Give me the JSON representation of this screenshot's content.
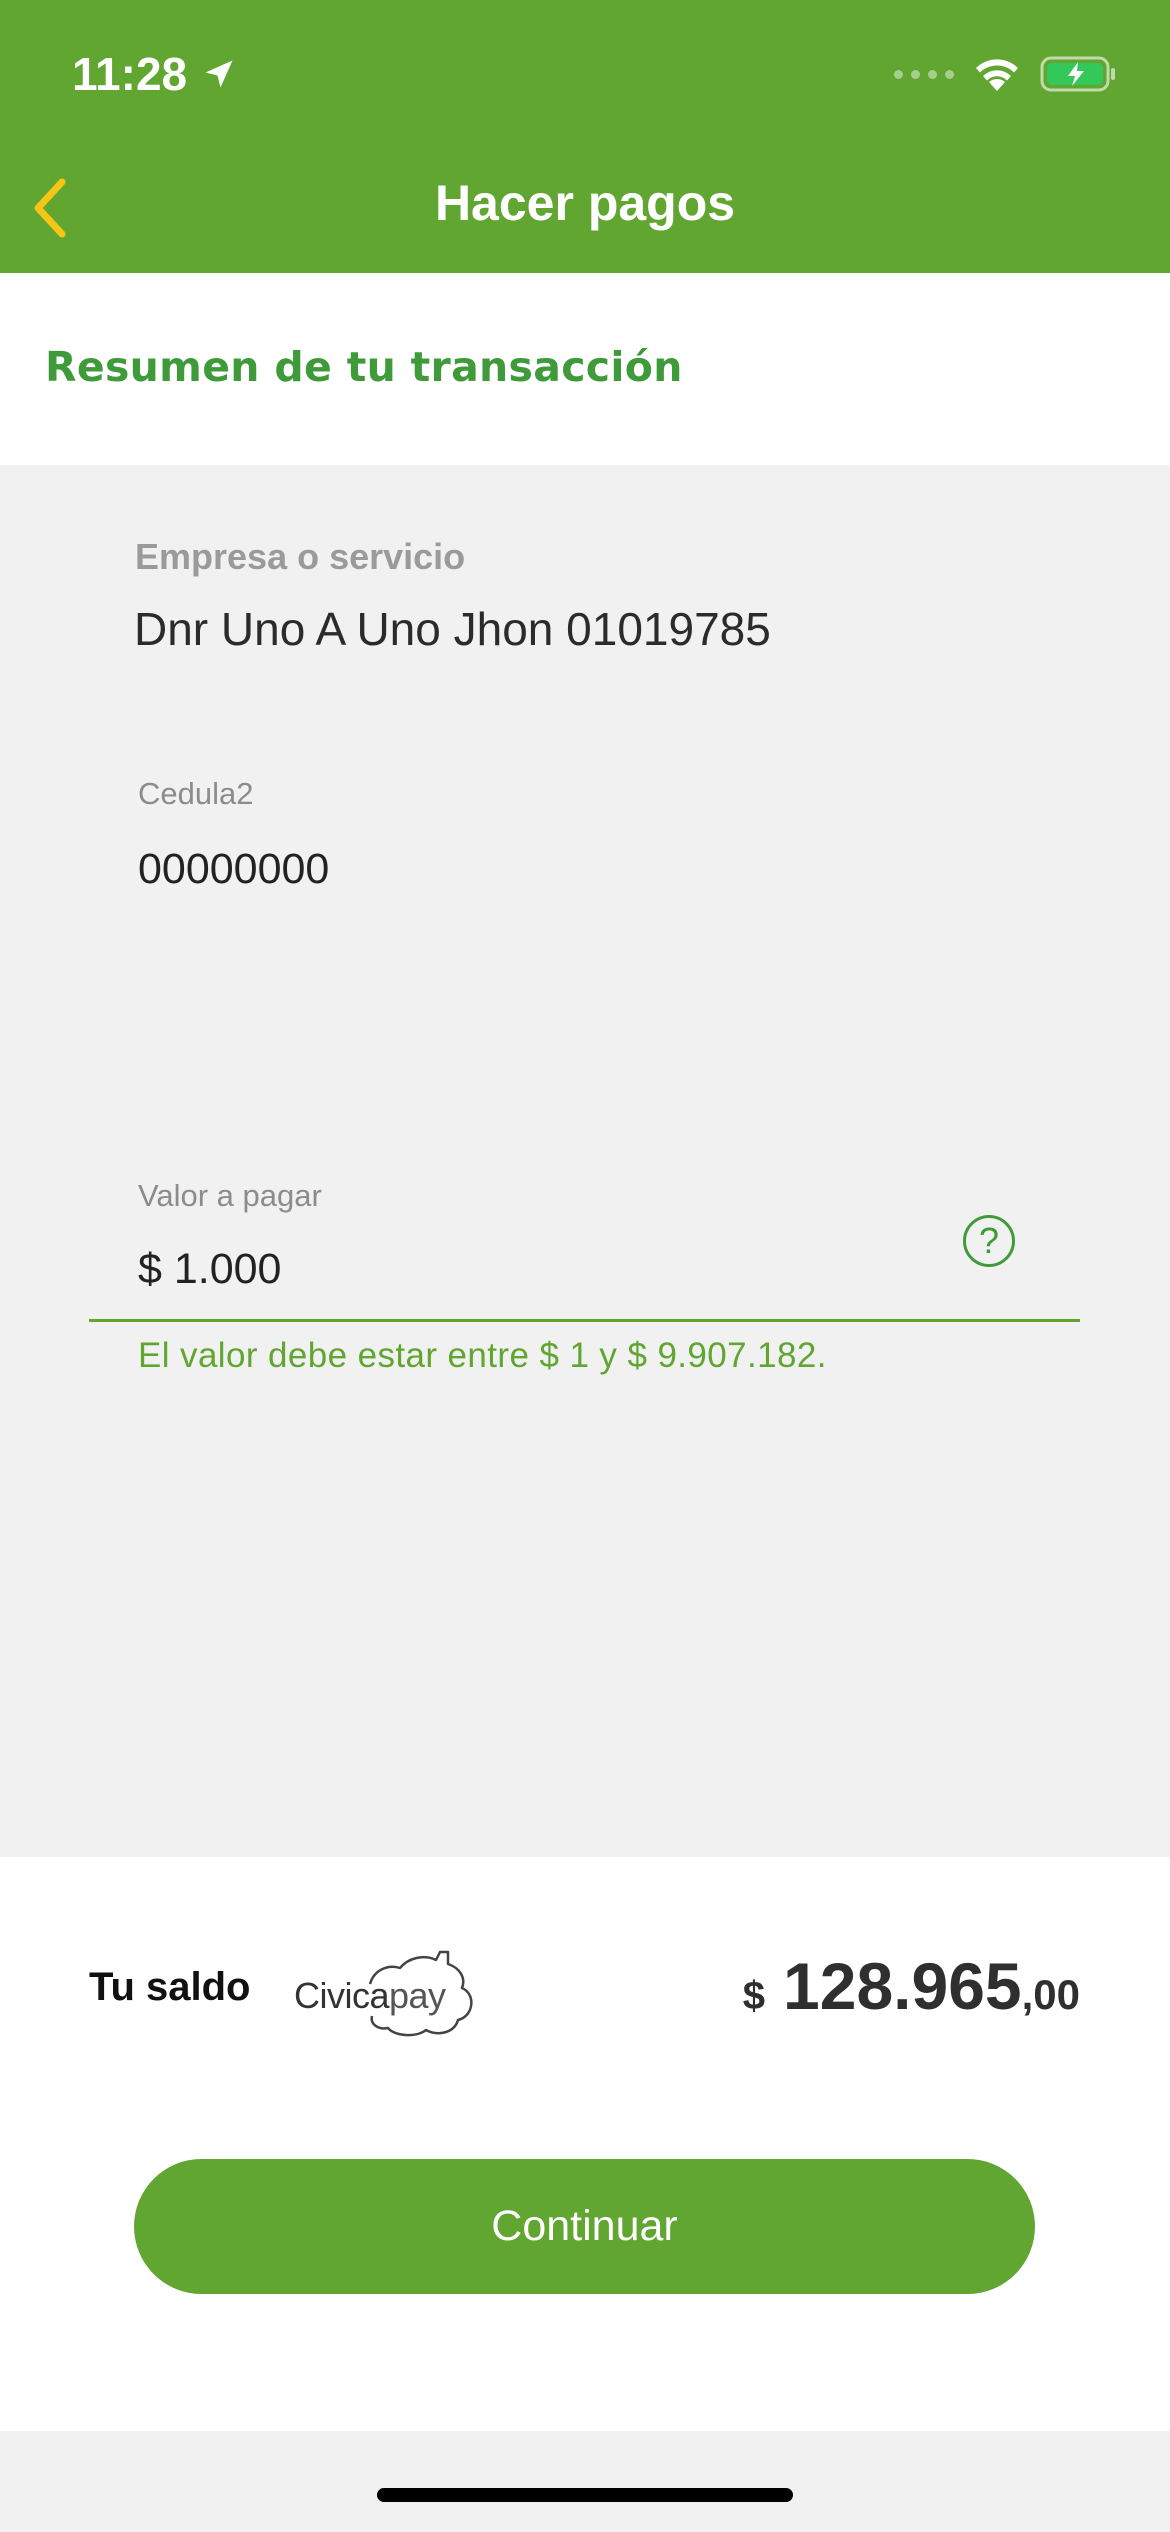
{
  "status_bar": {
    "time": "11:28",
    "location_icon": "location-arrow-icon",
    "signal_icon": "cellular-dots-icon",
    "wifi_icon": "wifi-icon",
    "battery_icon": "battery-charging-icon"
  },
  "header": {
    "title": "Hacer pagos",
    "back_icon": "chevron-left-icon",
    "background": "#60a630",
    "back_color": "#f5c518"
  },
  "summary": {
    "title": "Resumen de tu transacción"
  },
  "fields": {
    "company_label": "Empresa o servicio",
    "company_value": "Dnr Uno A Uno Jhon 01019785",
    "id_label": "Cedula2",
    "id_value": "00000000",
    "amount_label": "Valor a pagar",
    "amount_value": "$ 1.000",
    "help_symbol": "?",
    "hint": "El valor debe estar entre $ 1 y $ 9.907.182."
  },
  "balance": {
    "label": "Tu saldo",
    "logo_brand": "Civica",
    "logo_suffix": "pay",
    "currency": "$",
    "integer": "128.965",
    "decimals": ",00"
  },
  "actions": {
    "continue_label": "Continuar"
  }
}
